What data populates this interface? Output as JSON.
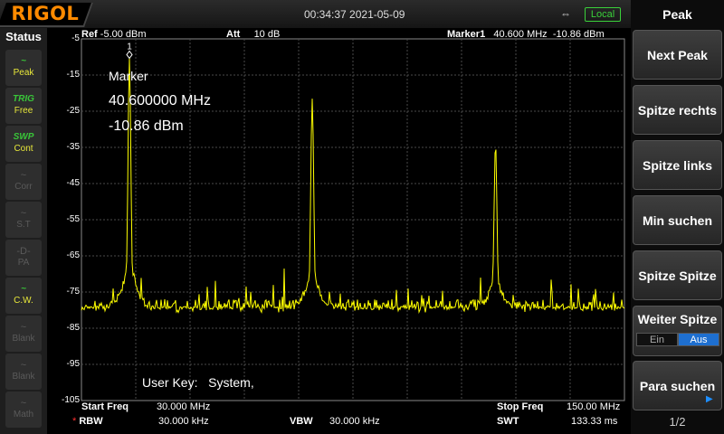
{
  "header": {
    "logo": "RIGOL",
    "datetime": "00:34:37 2021-05-09",
    "remote": "Local",
    "usb_icon": "usb-icon"
  },
  "status": {
    "title": "Status",
    "items": [
      {
        "glyph": "~",
        "label": "Peak",
        "state": "on"
      },
      {
        "glyph": "TRIG",
        "label": "Free",
        "state": "on"
      },
      {
        "glyph": "SWP",
        "label": "Cont",
        "state": "on"
      },
      {
        "glyph": "~",
        "label": "Corr",
        "state": "off"
      },
      {
        "glyph": "~",
        "label": "S.T",
        "state": "off"
      },
      {
        "glyph": "-D-",
        "label": "PA",
        "state": "off"
      },
      {
        "glyph": "~",
        "label": "C.W.",
        "state": "on"
      },
      {
        "glyph": "~",
        "label": "Blank",
        "state": "off"
      },
      {
        "glyph": "~",
        "label": "Blank",
        "state": "off"
      },
      {
        "glyph": "~",
        "label": "Math",
        "state": "off"
      }
    ]
  },
  "plot": {
    "ref": "-5.00 dBm",
    "ref_label": "Ref",
    "att_label": "Att",
    "att": "10 dB",
    "marker_label": "Marker1",
    "marker_freq": "40.600 MHz",
    "marker_level": "-10.86 dBm",
    "marker_num": "1",
    "overlay_title": "Marker",
    "overlay_freq": "40.600000 MHz",
    "overlay_level": "-10.86 dBm",
    "user_key": "User Key:",
    "user_key_value": "System,",
    "y_ticks": [
      "-5",
      "-15",
      "-25",
      "-35",
      "-45",
      "-55",
      "-65",
      "-75",
      "-85",
      "-95",
      "-105"
    ]
  },
  "footer": {
    "start_label": "Start Freq",
    "start": "30.000 MHz",
    "stop_label": "Stop Freq",
    "stop": "150.00 MHz",
    "rbw_label": "RBW",
    "rbw": "30.000 kHz",
    "vbw_label": "VBW",
    "vbw": "30.000 kHz",
    "swt_label": "SWT",
    "swt": "133.33 ms"
  },
  "menu": {
    "title": "Peak",
    "buttons": [
      "Next Peak",
      "Spitze rechts",
      "Spitze links",
      "Min suchen",
      "Spitze Spitze"
    ],
    "weiter_label": "Weiter Spitze",
    "toggle_off": "Ein",
    "toggle_on": "Aus",
    "para": "Para suchen",
    "page": "1/2"
  },
  "chart_data": {
    "type": "line",
    "xlim": [
      30,
      150
    ],
    "ylim": [
      -105,
      -5
    ],
    "trace_color": "#ffff00",
    "noise_floor": -80,
    "peaks": [
      {
        "x": 40.6,
        "y": -10.86
      },
      {
        "x": 81.0,
        "y": -21.5
      },
      {
        "x": 121.5,
        "y": -34.5
      }
    ]
  }
}
